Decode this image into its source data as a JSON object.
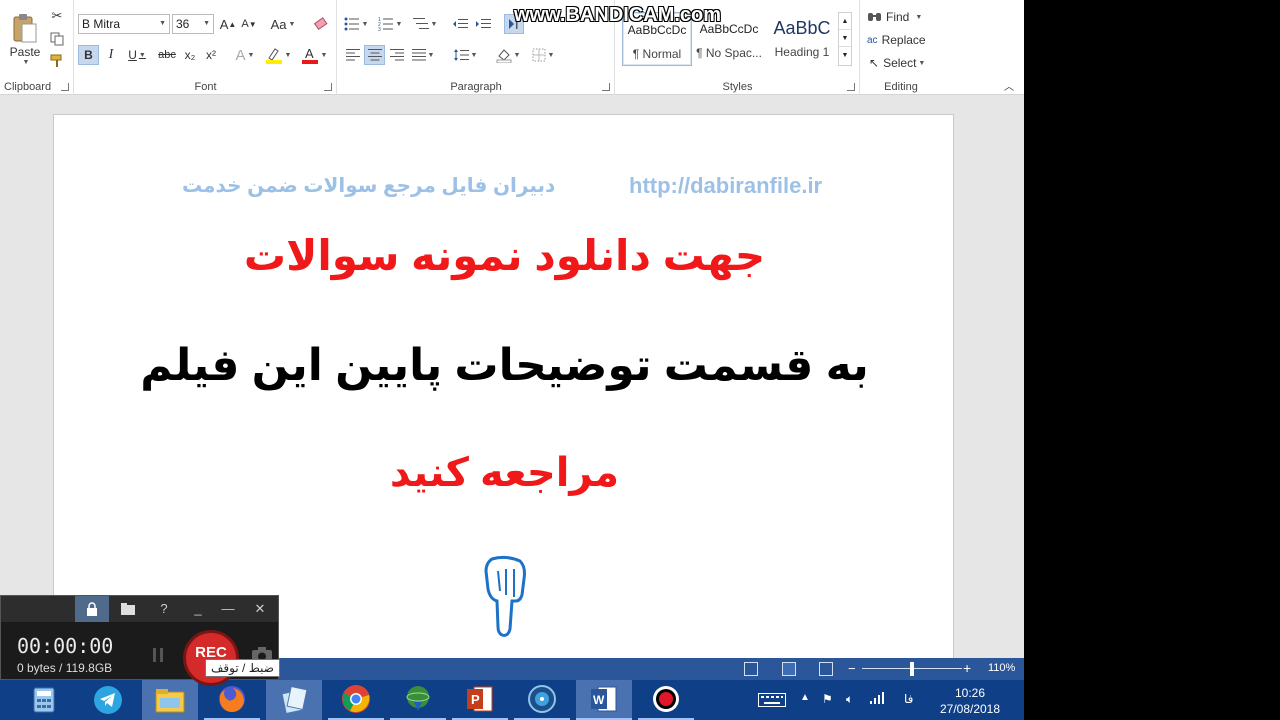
{
  "ribbon": {
    "clipboard": {
      "label": "Clipboard",
      "paste": "Paste"
    },
    "font": {
      "label": "Font",
      "name": "B Mitra",
      "size": "36",
      "bold": "B",
      "italic": "I",
      "underline": "U",
      "strike": "abc",
      "subscript": "x₂",
      "superscript": "x²",
      "grow": "A",
      "shrink": "A",
      "case": "Aa"
    },
    "paragraph": {
      "label": "Paragraph"
    },
    "styles": {
      "label": "Styles",
      "items": [
        {
          "preview": "AaBbCcDc",
          "name": "¶ Normal"
        },
        {
          "preview": "AaBbCcDc",
          "name": "¶ No Spac..."
        },
        {
          "preview": "AaBbC",
          "name": "Heading 1"
        }
      ]
    },
    "editing": {
      "label": "Editing",
      "find": "Find",
      "replace": "Replace",
      "select": "Select"
    }
  },
  "document": {
    "header_left": "دبیران فایل مرجع سوالات ضمن خدمت",
    "header_right": "http://dabiranfile.ir",
    "line1": "جهت دانلود نمونه سوالات",
    "line2": "به قسمت توضیحات پایین این فیلم",
    "line3": "مراجعه کنید",
    "colors": {
      "heading_red": "#f01818",
      "header_blue": "#9cc0e6"
    }
  },
  "statusbar": {
    "zoom": "110%"
  },
  "watermark": "www.BANDICAM.com",
  "recorder": {
    "timer": "00:00:00",
    "size": "0 bytes / 119.8GB",
    "rec_label": "REC",
    "tooltip": "ضبط / توقف",
    "title_buttons": [
      "?",
      "_",
      "—",
      "✕"
    ]
  },
  "taskbar": {
    "time": "10:26",
    "date": "27/08/2018",
    "lang": "فا",
    "apps": [
      "calculator",
      "telegram",
      "file-explorer",
      "firefox",
      "notepad",
      "chrome",
      "download-manager",
      "powerpoint",
      "media-player",
      "word",
      "bandicam"
    ]
  }
}
